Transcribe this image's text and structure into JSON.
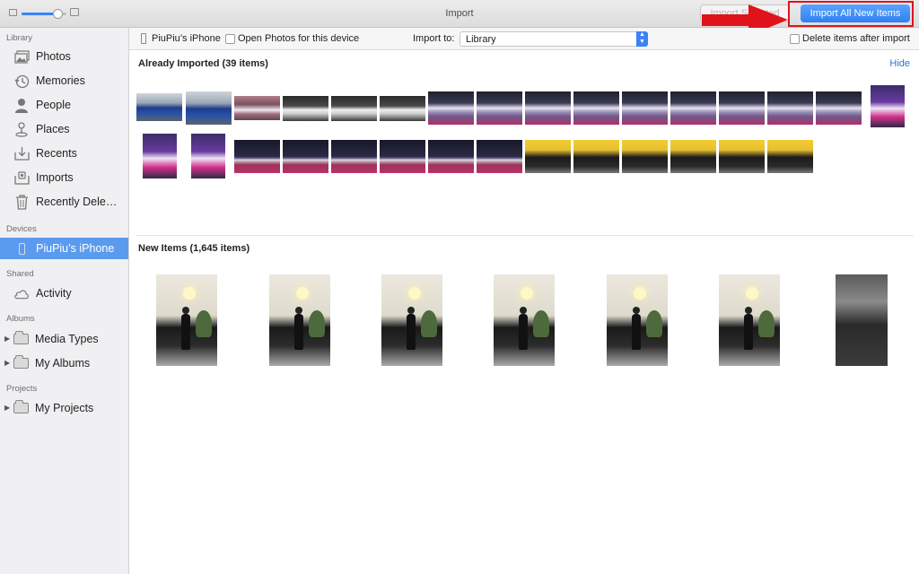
{
  "window": {
    "title": "Import"
  },
  "titlebar": {
    "import_selected_label": "Import Selected",
    "import_all_label": "Import All New Items",
    "accent_color": "#3b82f6",
    "annotation_color": "#e0131b"
  },
  "sidebar": {
    "library_heading": "Library",
    "library_items": [
      {
        "label": "Photos",
        "icon": "photos-icon"
      },
      {
        "label": "Memories",
        "icon": "memories-icon"
      },
      {
        "label": "People",
        "icon": "people-icon"
      },
      {
        "label": "Places",
        "icon": "places-icon"
      },
      {
        "label": "Recents",
        "icon": "recents-icon"
      },
      {
        "label": "Imports",
        "icon": "imports-icon"
      },
      {
        "label": "Recently Deleted",
        "icon": "trash-icon"
      }
    ],
    "devices_heading": "Devices",
    "device_item": {
      "label": "PiuPiu’s iPhone",
      "icon": "iphone-icon",
      "selected": true
    },
    "shared_heading": "Shared",
    "shared_item": {
      "label": "Activity",
      "icon": "cloud-icon"
    },
    "albums_heading": "Albums",
    "album_items": [
      {
        "label": "Media Types",
        "icon": "folder-icon"
      },
      {
        "label": "My Albums",
        "icon": "folder-icon"
      }
    ],
    "projects_heading": "Projects",
    "project_items": [
      {
        "label": "My Projects",
        "icon": "folder-icon"
      }
    ]
  },
  "toolbar": {
    "device_name": "PiuPiu’s iPhone",
    "open_photos_label": "Open Photos for this device",
    "import_to_label": "Import to:",
    "import_to_value": "Library",
    "delete_after_label": "Delete items after import"
  },
  "already_imported": {
    "title": "Already Imported (39 items)",
    "hide_label": "Hide"
  },
  "new_items": {
    "title": "New Items (1,645 items)"
  }
}
